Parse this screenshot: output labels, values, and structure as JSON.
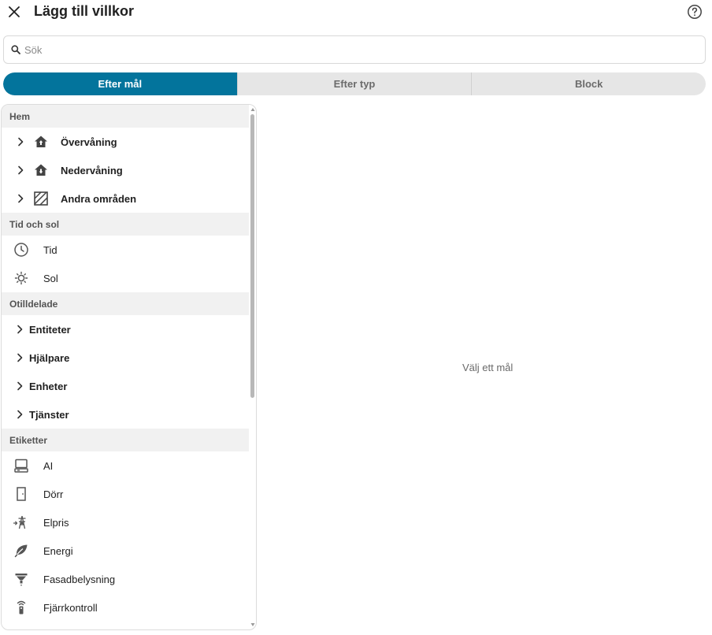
{
  "header": {
    "title": "Lägg till villkor",
    "close_icon": "close-icon",
    "help_icon": "help-circle-icon"
  },
  "search": {
    "placeholder": "Sök",
    "value": ""
  },
  "tabs": [
    {
      "label": "Efter mål",
      "active": true
    },
    {
      "label": "Efter typ",
      "active": false
    },
    {
      "label": "Block",
      "active": false
    }
  ],
  "colors": {
    "accent": "#03749c",
    "section_bg": "#f1f1f1",
    "tab_bg": "#e6e6e6"
  },
  "sections": {
    "home": {
      "header": "Hem",
      "items": [
        {
          "label": "Övervåning",
          "icon": "home-floor-up-icon"
        },
        {
          "label": "Nedervåning",
          "icon": "home-floor-down-icon"
        },
        {
          "label": "Andra områden",
          "icon": "hatched-square-icon"
        }
      ]
    },
    "time_sun": {
      "header": "Tid och sol",
      "items": [
        {
          "label": "Tid",
          "icon": "clock-icon"
        },
        {
          "label": "Sol",
          "icon": "sun-icon"
        }
      ]
    },
    "unassigned": {
      "header": "Otilldelade",
      "items": [
        {
          "label": "Entiteter"
        },
        {
          "label": "Hjälpare"
        },
        {
          "label": "Enheter"
        },
        {
          "label": "Tjänster"
        }
      ]
    },
    "labels": {
      "header": "Etiketter",
      "items": [
        {
          "label": "AI",
          "icon": "computer-icon"
        },
        {
          "label": "Dörr",
          "icon": "door-icon"
        },
        {
          "label": "Elpris",
          "icon": "transmission-tower-icon"
        },
        {
          "label": "Energi",
          "icon": "leaf-icon"
        },
        {
          "label": "Fasadbelysning",
          "icon": "facade-light-icon"
        },
        {
          "label": "Fjärrkontroll",
          "icon": "remote-icon"
        }
      ]
    }
  },
  "detail": {
    "empty_message": "Välj ett mål"
  }
}
